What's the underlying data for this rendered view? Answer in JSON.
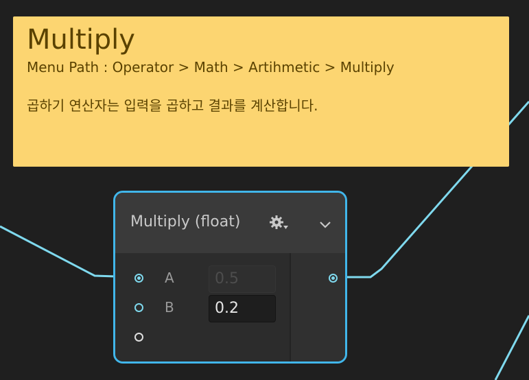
{
  "sticky_note": {
    "title": "Multiply",
    "menu_path": "Menu Path : Operator > Math > Artihmetic > Multiply",
    "description": "곱하기 연산자는 입력을 곱하고 결과를 계산합니다."
  },
  "node": {
    "title": "Multiply (float)",
    "settings_icon": "gear-icon",
    "collapse_icon": "chevron-down-icon",
    "inputs": [
      {
        "label": "A",
        "value": "0.5",
        "connected": true
      },
      {
        "label": "B",
        "value": "0.2",
        "connected": false
      }
    ],
    "output_connected": true
  },
  "colors": {
    "background": "#1f1f1f",
    "sticky": "#fcd571",
    "sticky_text": "#5a4200",
    "node_border": "#41b6ea",
    "wire": "#7fd9ee"
  }
}
